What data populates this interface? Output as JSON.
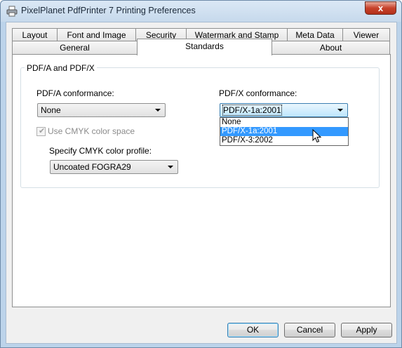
{
  "window": {
    "title": "PixelPlanet PdfPrinter 7 Printing Preferences",
    "close_glyph": "x"
  },
  "tabs": {
    "row1": [
      {
        "label": "Layout"
      },
      {
        "label": "Font and Image"
      },
      {
        "label": "Security"
      },
      {
        "label": "Watermark and Stamp"
      },
      {
        "label": "Meta Data"
      },
      {
        "label": "Viewer"
      }
    ],
    "row2": [
      {
        "label": "General"
      },
      {
        "label": "Standards",
        "active": true
      },
      {
        "label": "About"
      }
    ]
  },
  "group": {
    "title": "PDF/A and PDF/X",
    "pdfa_label": "PDF/A conformance:",
    "pdfa_value": "None",
    "pdfx_label": "PDF/X conformance:",
    "pdfx_value": "PDF/X-1a:2001",
    "pdfx_options": [
      "None",
      "PDF/X-1a:2001",
      "PDF/X-3:2002"
    ],
    "pdfx_highlighted": "PDF/X-1a:2001",
    "cmyk_checkbox_label": "Use CMYK color space",
    "cmyk_checked": true,
    "cmyk_enabled": false,
    "cmyk_profile_label": "Specify CMYK color profile:",
    "cmyk_profile_value": "Uncoated FOGRA29"
  },
  "buttons": {
    "ok": "OK",
    "cancel": "Cancel",
    "apply": "Apply"
  },
  "colors": {
    "selection": "#3399ff",
    "window_frame": "#bcd3ea",
    "close_button": "#c7422b"
  }
}
